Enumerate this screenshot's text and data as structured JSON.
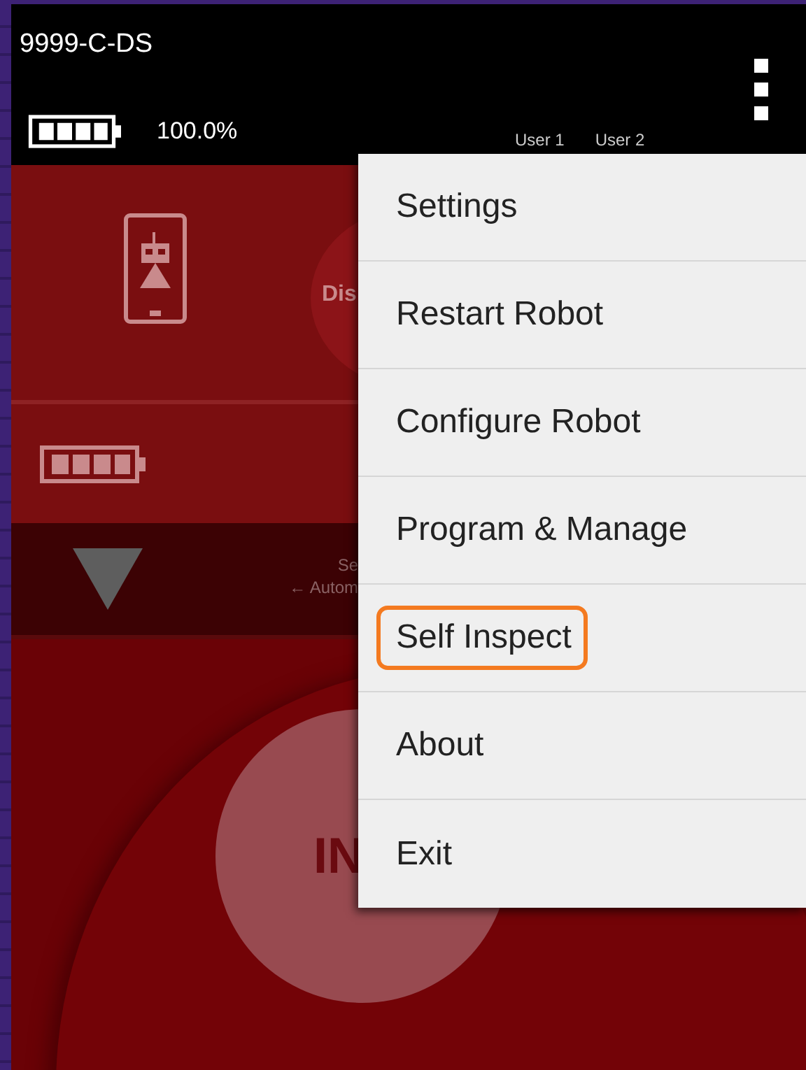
{
  "header": {
    "title": "9999-C-DS",
    "battery_reading": "100.0%",
    "user_labels": [
      "User 1",
      "User 2"
    ]
  },
  "status_panel": {
    "robot_status_fragment": "Dis",
    "selector_fragments": [
      "Se",
      "← Autom"
    ],
    "init_button_fragment": "IN"
  },
  "menu": {
    "items": [
      {
        "label": "Settings",
        "highlighted": false
      },
      {
        "label": "Restart Robot",
        "highlighted": false
      },
      {
        "label": "Configure Robot",
        "highlighted": false
      },
      {
        "label": "Program & Manage",
        "highlighted": false
      },
      {
        "label": "Self Inspect",
        "highlighted": true
      },
      {
        "label": "About",
        "highlighted": false
      },
      {
        "label": "Exit",
        "highlighted": false
      }
    ]
  }
}
